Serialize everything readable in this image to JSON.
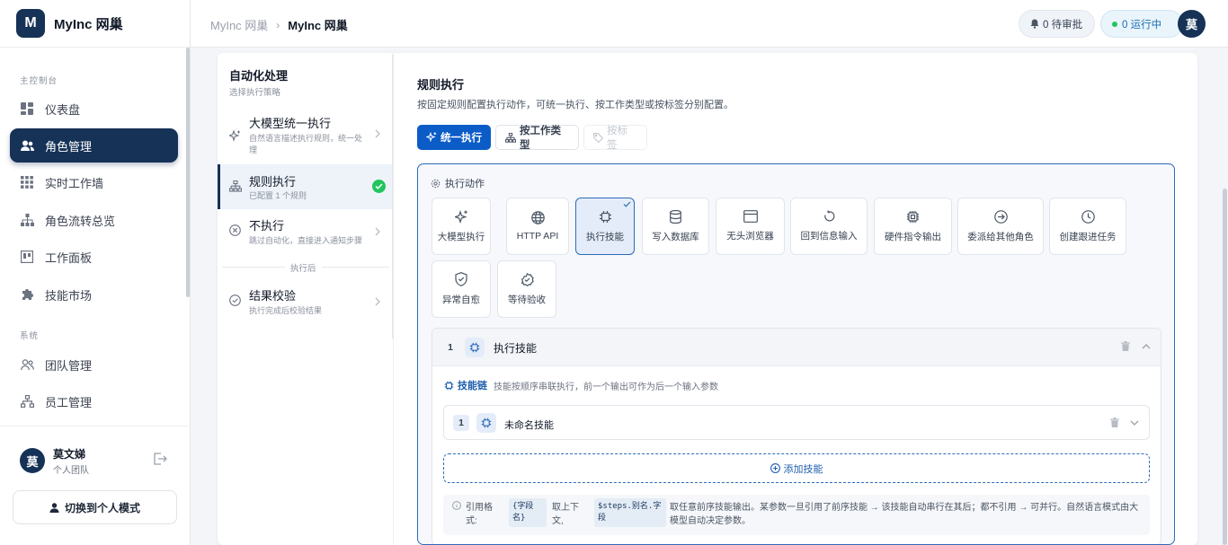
{
  "brand": {
    "logo_letter": "M",
    "name": "MyInc 网巢"
  },
  "sidebar": {
    "section_console": "主控制台",
    "section_system": "系统",
    "items": [
      {
        "label": "仪表盘",
        "icon": "dashboard-icon"
      },
      {
        "label": "角色管理",
        "icon": "users-icon",
        "active": true
      },
      {
        "label": "实时工作墙",
        "icon": "grid-icon"
      },
      {
        "label": "角色流转总览",
        "icon": "flow-icon"
      },
      {
        "label": "工作面板",
        "icon": "board-icon"
      },
      {
        "label": "技能市场",
        "icon": "puzzle-icon"
      },
      {
        "label": "团队管理",
        "icon": "team-icon"
      },
      {
        "label": "员工管理",
        "icon": "org-icon"
      }
    ],
    "user": {
      "avatar": "莫",
      "name": "莫文娣",
      "team": "个人团队"
    },
    "switch_label": "切换到个人模式"
  },
  "header": {
    "breadcrumb": [
      "MyInc 网巢",
      "MyInc 网巢"
    ],
    "pending_label": "0 待审批",
    "running_label": "0 运行中",
    "avatar": "莫"
  },
  "strategy": {
    "title": "自动化处理",
    "subtitle": "选择执行策略",
    "options": [
      {
        "label": "大模型统一执行",
        "desc": "自然语言描述执行规则，统一处理"
      },
      {
        "label": "规则执行",
        "desc": "已配置 1 个规则",
        "selected": true
      },
      {
        "label": "不执行",
        "desc": "跳过自动化，直接进入通知步骤"
      }
    ],
    "after_label": "执行后",
    "after_options": [
      {
        "label": "结果校验",
        "desc": "执行完成后校验结果"
      }
    ]
  },
  "rules": {
    "title": "规则执行",
    "desc": "按固定规则配置执行动作，可统一执行、按工作类型或按标签分别配置。",
    "modes": [
      "统一执行",
      "按工作类型",
      "按标签"
    ],
    "action_title": "执行动作",
    "actions": [
      {
        "label": "大模型执行",
        "icon": "sparkle-icon"
      },
      {
        "label": "HTTP API",
        "icon": "globe-icon"
      },
      {
        "label": "执行技能",
        "icon": "chip-icon",
        "selected": true
      },
      {
        "label": "写入数据库",
        "icon": "database-icon"
      },
      {
        "label": "无头浏览器",
        "icon": "browser-icon"
      },
      {
        "label": "回到信息输入",
        "icon": "rotate-icon"
      },
      {
        "label": "硬件指令输出",
        "icon": "hardware-icon"
      },
      {
        "label": "委派给其他角色",
        "icon": "arrow-circle-icon"
      },
      {
        "label": "创建跟进任务",
        "icon": "clock-icon"
      },
      {
        "label": "异常自愈",
        "icon": "shield-check-icon"
      },
      {
        "label": "等待验收",
        "icon": "check-badge-icon"
      }
    ],
    "step": {
      "number": "1",
      "label": "执行技能",
      "chain_label": "技能链",
      "chain_hint": "技能按顺序串联执行，前一个输出可作为后一个输入参数",
      "skill": {
        "number": "1",
        "label": "未命名技能"
      },
      "add_label": "添加技能",
      "ref_a": "引用格式:",
      "ref_code1": "{字段名}",
      "ref_b": "取上下文,",
      "ref_code2": "$steps.别名.字段",
      "ref_c": "取任意前序技能输出。某参数一旦引用了前序技能 → 该技能自动串行在其后；都不引用 → 可并行。自然语言模式由大模型自动决定参数。"
    }
  },
  "colors": {
    "brand": "#163257",
    "primary": "#0b5cc7",
    "success": "#22c55e"
  }
}
